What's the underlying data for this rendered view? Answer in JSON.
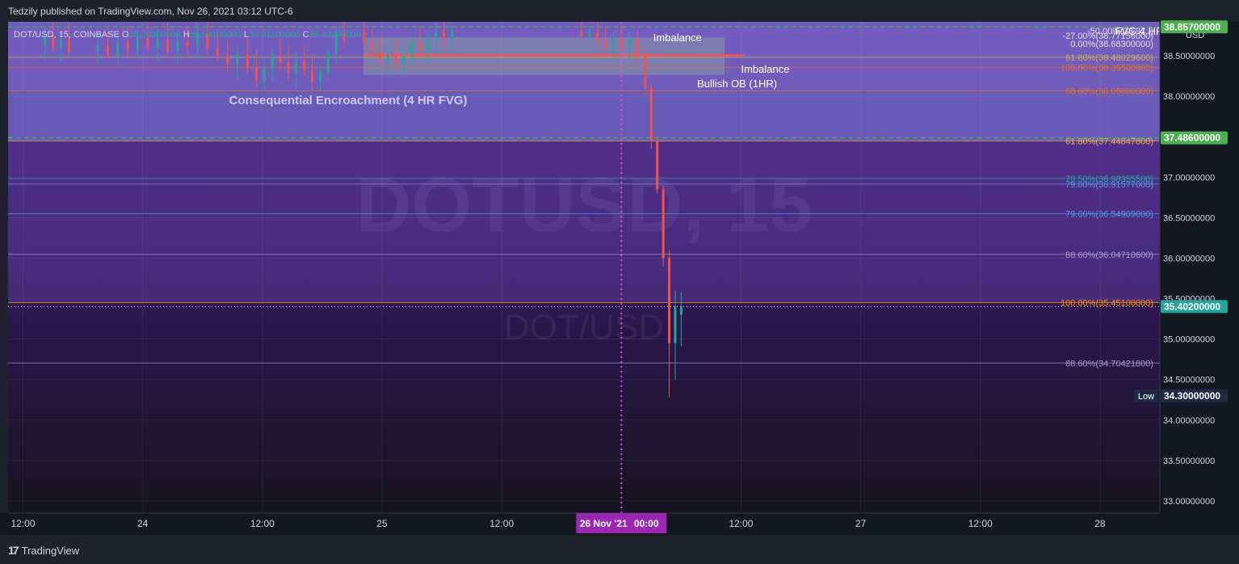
{
  "header": {
    "publish_line": "Tedzily published on TradingView.com, Nov 26, 2021 03:12 UTC-6"
  },
  "legend": {
    "symbol": "DOT/USD, 15, COINBASE",
    "o_label": "O",
    "o_value": "35.30300000",
    "h_label": "H",
    "h_value": "35.58100000",
    "l_label": "L",
    "l_value": "34.91100000",
    "c_label": "C",
    "c_value": "35.40200000"
  },
  "watermark": {
    "main": "DOTUSD, 15",
    "sub": "DOT/USD"
  },
  "footer": {
    "brand": "TradingView"
  },
  "colors": {
    "background": "#131722",
    "zone_upper": "#7b6fc9",
    "zone_lower": "#5a3b96",
    "price_up": "#26a69a",
    "price_down": "#ef5350",
    "price_tag_green": "#4caf50",
    "price_tag_teal": "#26a69a",
    "date_tag": "#9c27b0"
  },
  "chart_data": {
    "type": "candlestick",
    "y_axis": {
      "currency": "USD",
      "ylim": [
        32.85,
        38.92
      ],
      "ticks": [
        "33.00000000",
        "33.50000000",
        "34.00000000",
        "34.50000000",
        "35.00000000",
        "35.50000000",
        "36.00000000",
        "36.50000000",
        "37.00000000",
        "37.50000000",
        "38.00000000",
        "38.50000000"
      ],
      "tick_values": [
        33.0,
        33.5,
        34.0,
        34.5,
        35.0,
        35.5,
        36.0,
        36.5,
        37.0,
        37.5,
        38.0,
        38.5
      ]
    },
    "x_axis": {
      "labels": [
        "12:00",
        "24",
        "12:00",
        "25",
        "12:00",
        "00:00",
        "12:00",
        "27",
        "12:00",
        "28"
      ],
      "label_hours": [
        -36,
        -24,
        -12,
        0,
        12,
        24,
        36,
        48,
        60,
        72
      ]
    },
    "x_origin": "25 Nov 2021 00:00",
    "x_end_hour": 78,
    "price_tags": [
      {
        "text": "38.85700000",
        "value": 38.857,
        "color": "green"
      },
      {
        "text": "37.48600000",
        "value": 37.486,
        "color": "green"
      },
      {
        "text": "35.40200000",
        "value": 35.402,
        "color": "teal"
      },
      {
        "text": "34.30000000",
        "value": 34.3,
        "color": "dark",
        "label": "Low"
      }
    ],
    "date_tag": {
      "date": "26 Nov '21",
      "time": "00:00",
      "hour": 24
    },
    "fib_levels": [
      {
        "label": "61.80%(38.48029600)",
        "value": 38.4803,
        "color": "#c9b458"
      },
      {
        "label": "100.00%(38.35500000)",
        "value": 38.355,
        "color": "#e5702a"
      },
      {
        "label": "88.60%(38.06660000)",
        "value": 38.0666,
        "color": "#e5702a"
      },
      {
        "label": "61.80%(37.44847800)",
        "value": 37.4485,
        "color": "#e8b84a"
      },
      {
        "label": "70.50%(36.98355500)",
        "value": 36.9836,
        "color": "#26a69a"
      },
      {
        "label": "79.00%(36.91577000)",
        "value": 36.9158,
        "color": "#4f9ce8"
      },
      {
        "label": "79.00%(36.54909000)",
        "value": 36.5491,
        "color": "#4f9ce8"
      },
      {
        "label": "88.60%(36.04710600)",
        "value": 36.0471,
        "color": "#a89bd6"
      },
      {
        "label": "100.00%(35.45100000)",
        "value": 35.451,
        "color": "#ff9800"
      },
      {
        "label": "88.60%(34.70421800)",
        "value": 34.7042,
        "color": "#a89bd6"
      }
    ],
    "top_labels": [
      {
        "label": "-50.00%(38.97..)",
        "value": 38.81
      },
      {
        "label": "-27.00%(38.77156000)",
        "value": 38.75
      },
      {
        "label": "0.00%(38.68300000)",
        "value": 38.65
      }
    ],
    "annotations": [
      {
        "text": "Imbalance",
        "x_hour": 27.2,
        "value": 38.73
      },
      {
        "text": "Imbalance",
        "x_hour": 36,
        "value": 38.34
      },
      {
        "text": "Bullish OB (1HR)",
        "x_hour": 31.6,
        "value": 38.16
      },
      {
        "text": "Consequential Encroachment (4 HR FVG)",
        "x_hour": -3.4,
        "value": 37.95
      },
      {
        "text": "FVG 4 HR",
        "x_hour": 73.5,
        "value": 38.81
      }
    ],
    "series": [
      {
        "hour": -33.8,
        "open": 38.62,
        "high": 38.86,
        "low": 38.45,
        "close": 38.75
      },
      {
        "hour": -33.0,
        "open": 38.75,
        "high": 38.92,
        "low": 38.55,
        "close": 38.6
      },
      {
        "hour": -32.2,
        "open": 38.6,
        "high": 38.8,
        "low": 38.42,
        "close": 38.7
      },
      {
        "hour": -31.4,
        "open": 38.7,
        "high": 38.9,
        "low": 38.5,
        "close": 38.55
      },
      {
        "hour": -28.5,
        "open": 38.55,
        "high": 38.78,
        "low": 38.4,
        "close": 38.62
      },
      {
        "hour": -27.5,
        "open": 38.62,
        "high": 38.8,
        "low": 38.48,
        "close": 38.5
      },
      {
        "hour": -26.5,
        "open": 38.5,
        "high": 38.74,
        "low": 38.38,
        "close": 38.66
      },
      {
        "hour": -25.5,
        "open": 38.66,
        "high": 38.86,
        "low": 38.5,
        "close": 38.58
      },
      {
        "hour": -24.5,
        "open": 38.58,
        "high": 38.82,
        "low": 38.46,
        "close": 38.72
      },
      {
        "hour": -23.5,
        "open": 38.72,
        "high": 38.9,
        "low": 38.55,
        "close": 38.6
      },
      {
        "hour": -22.5,
        "open": 38.6,
        "high": 38.84,
        "low": 38.44,
        "close": 38.7
      },
      {
        "hour": -21.5,
        "open": 38.7,
        "high": 38.9,
        "low": 38.52,
        "close": 38.56
      },
      {
        "hour": -20.5,
        "open": 38.56,
        "high": 38.8,
        "low": 38.4,
        "close": 38.68
      },
      {
        "hour": -19.5,
        "open": 38.68,
        "high": 38.88,
        "low": 38.5,
        "close": 38.62
      },
      {
        "hour": -18.5,
        "open": 38.62,
        "high": 38.9,
        "low": 38.46,
        "close": 38.78
      },
      {
        "hour": -17.5,
        "open": 38.78,
        "high": 38.92,
        "low": 38.52,
        "close": 38.6
      },
      {
        "hour": -16.5,
        "open": 38.6,
        "high": 38.82,
        "low": 38.44,
        "close": 38.5
      },
      {
        "hour": -15.5,
        "open": 38.5,
        "high": 38.7,
        "low": 38.3,
        "close": 38.4
      },
      {
        "hour": -14.5,
        "open": 38.4,
        "high": 38.62,
        "low": 38.2,
        "close": 38.52
      },
      {
        "hour": -13.5,
        "open": 38.52,
        "high": 38.72,
        "low": 38.28,
        "close": 38.36
      },
      {
        "hour": -12.6,
        "open": 38.36,
        "high": 38.58,
        "low": 38.1,
        "close": 38.2
      },
      {
        "hour": -11.8,
        "open": 38.2,
        "high": 38.46,
        "low": 38.08,
        "close": 38.34
      },
      {
        "hour": -11.0,
        "open": 38.34,
        "high": 38.6,
        "low": 38.18,
        "close": 38.5
      },
      {
        "hour": -10.2,
        "open": 38.5,
        "high": 38.72,
        "low": 38.3,
        "close": 38.42
      },
      {
        "hour": -9.4,
        "open": 38.42,
        "high": 38.62,
        "low": 38.2,
        "close": 38.3
      },
      {
        "hour": -8.6,
        "open": 38.3,
        "high": 38.55,
        "low": 38.12,
        "close": 38.44
      },
      {
        "hour": -7.8,
        "open": 38.44,
        "high": 38.64,
        "low": 38.25,
        "close": 38.32
      },
      {
        "hour": -7.0,
        "open": 38.32,
        "high": 38.52,
        "low": 38.08,
        "close": 38.18
      },
      {
        "hour": -6.2,
        "open": 38.18,
        "high": 38.4,
        "low": 38.06,
        "close": 38.3
      },
      {
        "hour": -5.4,
        "open": 38.3,
        "high": 38.6,
        "low": 38.2,
        "close": 38.54
      },
      {
        "hour": -4.6,
        "open": 38.54,
        "high": 38.86,
        "low": 38.4,
        "close": 38.78
      },
      {
        "hour": -3.8,
        "open": 38.78,
        "high": 38.92,
        "low": 38.6,
        "close": 38.7
      },
      {
        "hour": -1.8,
        "open": 38.8,
        "high": 38.92,
        "low": 38.6,
        "close": 38.66
      },
      {
        "hour": -1.0,
        "open": 38.66,
        "high": 38.84,
        "low": 38.5,
        "close": 38.56
      },
      {
        "hour": -0.2,
        "open": 38.56,
        "high": 38.72,
        "low": 38.38,
        "close": 38.46
      },
      {
        "hour": 0.6,
        "open": 38.46,
        "high": 38.62,
        "low": 38.3,
        "close": 38.52
      },
      {
        "hour": 1.4,
        "open": 38.52,
        "high": 38.7,
        "low": 38.34,
        "close": 38.4
      },
      {
        "hour": 2.2,
        "open": 38.4,
        "high": 38.6,
        "low": 38.28,
        "close": 38.5
      },
      {
        "hour": 3.0,
        "open": 38.5,
        "high": 38.74,
        "low": 38.36,
        "close": 38.66
      },
      {
        "hour": 3.8,
        "open": 38.66,
        "high": 38.84,
        "low": 38.48,
        "close": 38.56
      },
      {
        "hour": 4.6,
        "open": 38.56,
        "high": 38.78,
        "low": 38.42,
        "close": 38.7
      },
      {
        "hour": 5.4,
        "open": 38.7,
        "high": 38.9,
        "low": 38.55,
        "close": 38.8
      },
      {
        "hour": 6.2,
        "open": 38.8,
        "high": 38.92,
        "low": 38.62,
        "close": 38.7
      },
      {
        "hour": 7.0,
        "open": 38.7,
        "high": 38.88,
        "low": 38.56,
        "close": 38.82
      },
      {
        "hour": 20.0,
        "open": 38.8,
        "high": 38.92,
        "low": 38.68,
        "close": 38.74
      },
      {
        "hour": 20.8,
        "open": 38.74,
        "high": 38.88,
        "low": 38.6,
        "close": 38.8
      },
      {
        "hour": 21.6,
        "open": 38.8,
        "high": 38.92,
        "low": 38.62,
        "close": 38.68
      },
      {
        "hour": 22.4,
        "open": 38.68,
        "high": 38.86,
        "low": 38.5,
        "close": 38.6
      },
      {
        "hour": 23.2,
        "open": 38.6,
        "high": 38.8,
        "low": 38.48,
        "close": 38.72
      },
      {
        "hour": 24.0,
        "open": 38.72,
        "high": 38.88,
        "low": 38.55,
        "close": 38.62
      },
      {
        "hour": 24.8,
        "open": 38.62,
        "high": 38.8,
        "low": 38.46,
        "close": 38.7
      },
      {
        "hour": 25.6,
        "open": 38.7,
        "high": 38.82,
        "low": 38.4,
        "close": 38.5
      },
      {
        "hour": 26.4,
        "open": 38.5,
        "high": 38.6,
        "low": 38.0,
        "close": 38.1
      },
      {
        "hour": 27.0,
        "open": 38.1,
        "high": 38.15,
        "low": 37.35,
        "close": 37.45
      },
      {
        "hour": 27.6,
        "open": 37.45,
        "high": 37.5,
        "low": 36.8,
        "close": 36.85
      },
      {
        "hour": 28.2,
        "open": 36.85,
        "high": 36.9,
        "low": 35.9,
        "close": 36.0
      },
      {
        "hour": 28.8,
        "open": 36.0,
        "high": 36.1,
        "low": 34.28,
        "close": 34.95
      },
      {
        "hour": 29.4,
        "open": 34.95,
        "high": 35.6,
        "low": 34.5,
        "close": 35.4
      },
      {
        "hour": 30.0,
        "open": 35.303,
        "high": 35.581,
        "low": 34.911,
        "close": 35.402
      }
    ]
  }
}
